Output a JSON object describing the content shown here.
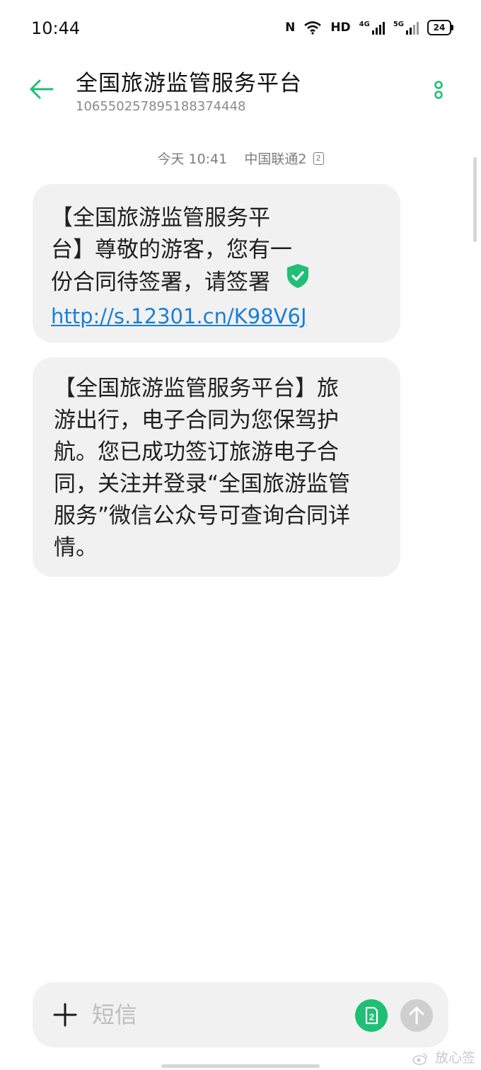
{
  "status_bar": {
    "time": "10:44",
    "nfc": "N",
    "hd": "HD",
    "signal1": "4G",
    "signal2": "5G",
    "battery": "24"
  },
  "header": {
    "title": "全国旅游监管服务平台",
    "number": "106550257895188374448"
  },
  "conversation": {
    "meta_time": "今天 10:41",
    "meta_carrier": "中国联通2",
    "sim_badge": "2"
  },
  "messages": [
    {
      "lines": [
        "【全国旅游监管服务平",
        "台】尊敬的游客，您有一",
        "份合同待签署，请签署"
      ],
      "link": "http://s.12301.cn/K98V6J"
    },
    {
      "lines": [
        "【全国旅游监管服务平台】旅",
        "游出行，电子合同为您保驾护",
        "航。您已成功签订旅游电子合",
        "同，关注并登录“全国旅游监管",
        "服务”微信公众号可查询合同详",
        "情。"
      ]
    }
  ],
  "composer": {
    "placeholder": "短信",
    "sim_label": "2"
  },
  "watermark": "放心签",
  "icons": {
    "back": "back-arrow-icon",
    "menu": "more-vertical-icon",
    "shield": "verified-shield-icon",
    "plus": "plus-icon",
    "send": "send-arrow-icon"
  },
  "colors": {
    "accent": "#1fbf75",
    "link": "#1a7fd6",
    "bubble": "#f1f1f1"
  }
}
